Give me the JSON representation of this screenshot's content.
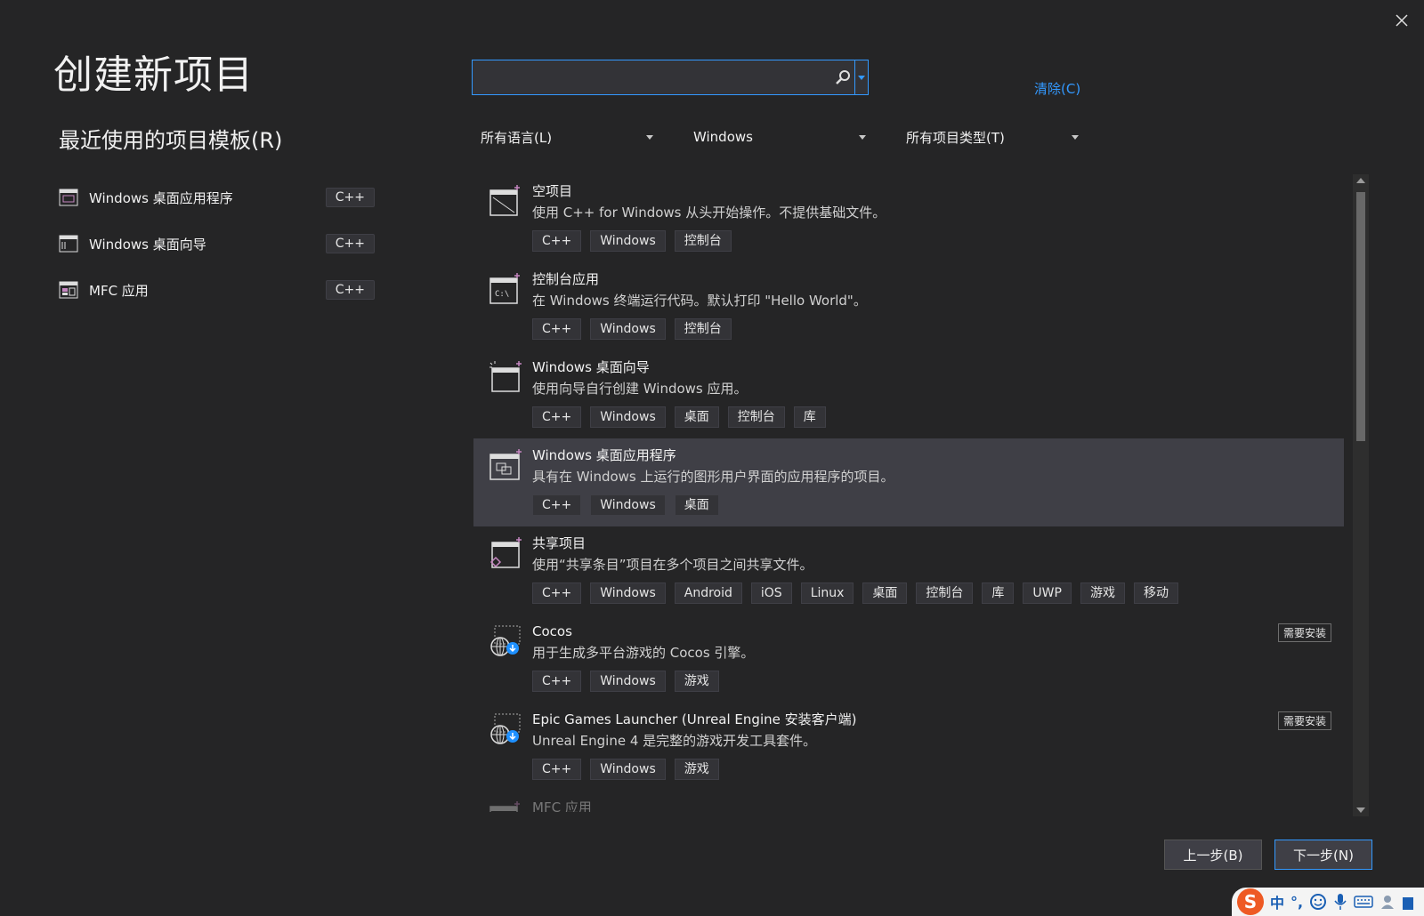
{
  "window": {
    "title": "创建新项目"
  },
  "recent": {
    "title": "最近使用的项目模板(R)",
    "items": [
      {
        "label": "Windows 桌面应用程序",
        "lang": "C++",
        "icon": "windows-app-icon"
      },
      {
        "label": "Windows 桌面向导",
        "lang": "C++",
        "icon": "wizard-icon"
      },
      {
        "label": "MFC 应用",
        "lang": "C++",
        "icon": "mfc-app-icon"
      }
    ]
  },
  "search": {
    "value": "",
    "placeholder": ""
  },
  "clear_label": "清除(C)",
  "filters": {
    "language": "所有语言(L)",
    "platform": "Windows",
    "project_type": "所有项目类型(T)"
  },
  "templates": [
    {
      "name": "空项目",
      "desc": "使用 C++ for Windows 从头开始操作。不提供基础文件。",
      "tags": [
        "C++",
        "Windows",
        "控制台"
      ],
      "icon": "empty-project-icon"
    },
    {
      "name": "控制台应用",
      "desc": "在 Windows 终端运行代码。默认打印 \"Hello World\"。",
      "tags": [
        "C++",
        "Windows",
        "控制台"
      ],
      "icon": "console-app-icon"
    },
    {
      "name": "Windows 桌面向导",
      "desc": "使用向导自行创建 Windows 应用。",
      "tags": [
        "C++",
        "Windows",
        "桌面",
        "控制台",
        "库"
      ],
      "icon": "wizard-icon"
    },
    {
      "name": "Windows 桌面应用程序",
      "desc": "具有在 Windows 上运行的图形用户界面的应用程序的项目。",
      "tags": [
        "C++",
        "Windows",
        "桌面"
      ],
      "icon": "windows-app-icon",
      "selected": true
    },
    {
      "name": "共享项目",
      "desc": "使用“共享条目”项目在多个项目之间共享文件。",
      "tags": [
        "C++",
        "Windows",
        "Android",
        "iOS",
        "Linux",
        "桌面",
        "控制台",
        "库",
        "UWP",
        "游戏",
        "移动"
      ],
      "icon": "shared-project-icon"
    },
    {
      "name": "Cocos",
      "desc": "用于生成多平台游戏的 Cocos 引擎。",
      "tags": [
        "C++",
        "Windows",
        "游戏"
      ],
      "icon": "globe-download-icon",
      "badge": "需要安装"
    },
    {
      "name": "Epic Games Launcher (Unreal Engine 安装客户端)",
      "desc": "Unreal Engine 4 是完整的游戏开发工具套件。",
      "tags": [
        "C++",
        "Windows",
        "游戏"
      ],
      "icon": "globe-download-icon",
      "badge": "需要安装"
    },
    {
      "name": "MFC 应用",
      "desc": "",
      "tags": [],
      "icon": "mfc-app-icon",
      "faded": true
    }
  ],
  "buttons": {
    "back": "上一步(B)",
    "next": "下一步(N)"
  },
  "ime": {
    "logo": "S",
    "mode": "中",
    "punct": "°,"
  }
}
